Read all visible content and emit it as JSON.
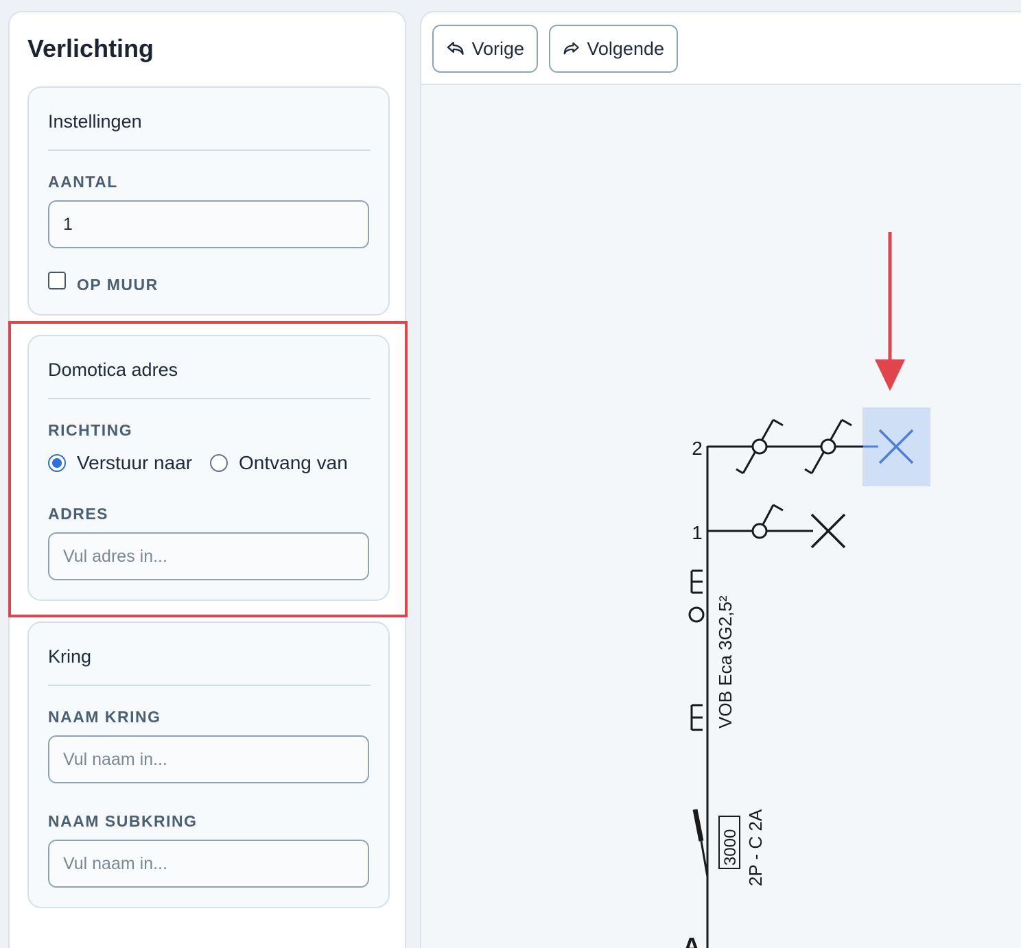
{
  "panel": {
    "title": "Verlichting"
  },
  "instellingen": {
    "title": "Instellingen",
    "aantal_label": "AANTAL",
    "aantal_value": "1",
    "op_muur_label": "OP MUUR",
    "op_muur_checked": false
  },
  "domotica": {
    "title": "Domotica adres",
    "richting_label": "RICHTING",
    "options": [
      "Verstuur naar",
      "Ontvang van"
    ],
    "selected": "Verstuur naar",
    "adres_label": "ADRES",
    "adres_placeholder": "Vul adres in..."
  },
  "kring": {
    "title": "Kring",
    "naam_kring_label": "NAAM KRING",
    "naam_kring_placeholder": "Vul naam in...",
    "naam_subkring_label": "NAAM SUBKRING",
    "naam_subkring_placeholder": "Vul naam in..."
  },
  "toolbar": {
    "prev_label": "Vorige",
    "next_label": "Volgende"
  },
  "diagram": {
    "circuit_numbers": [
      "2",
      "1"
    ],
    "cable_label": "VOB Eca 3G2,5²",
    "breaker_rating": "3000",
    "breaker_type": "2P - C 2A",
    "bottom_label": "A",
    "highlight_color": "#cfdff5",
    "selected_color": "#4a7fe0",
    "arrow_color": "#e0454b"
  },
  "icons": [
    "undo-icon",
    "redo-icon",
    "lamp-icon",
    "switch-icon",
    "circuit-breaker-icon",
    "ground-icon",
    "arrow-down-icon"
  ]
}
